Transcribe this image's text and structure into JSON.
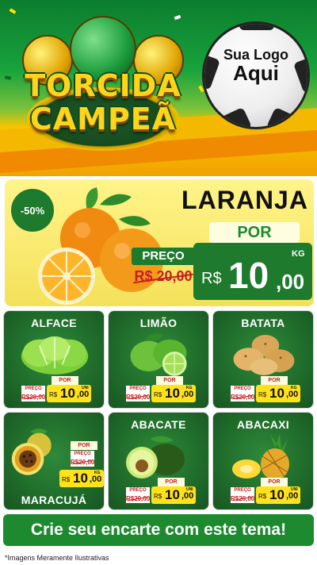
{
  "header": {
    "title_line1": "TORCIDA",
    "title_line2": "CAMPEÃ",
    "logo_line1": "Sua Logo",
    "logo_line2": "Aqui"
  },
  "featured": {
    "discount": "-50%",
    "name": "LARANJA",
    "por_label": "POR",
    "preco_label": "PREÇO",
    "old_price": "R$ 20,00",
    "currency": "R$",
    "price_int": "10",
    "price_dec": ",00",
    "unit": "KG"
  },
  "products": [
    {
      "name": "ALFACE",
      "por": "POR",
      "preco_label": "PREÇO",
      "old_price": "R$20,00",
      "currency": "R$",
      "price_int": "10",
      "price_dec": ",00",
      "unit": "UNI"
    },
    {
      "name": "LIMÃO",
      "por": "POR",
      "preco_label": "PREÇO",
      "old_price": "R$20,00",
      "currency": "R$",
      "price_int": "10",
      "price_dec": ",00",
      "unit": "KG"
    },
    {
      "name": "BATATA",
      "por": "POR",
      "preco_label": "PREÇO",
      "old_price": "R$20,00",
      "currency": "R$",
      "price_int": "10",
      "price_dec": ",00",
      "unit": "KG"
    },
    {
      "name": "MARACUJÁ",
      "por": "POR",
      "preco_label": "PREÇO",
      "old_price": "R$20,00",
      "currency": "R$",
      "price_int": "10",
      "price_dec": ",00",
      "unit": "KG"
    },
    {
      "name": "ABACATE",
      "por": "POR",
      "preco_label": "PREÇO",
      "old_price": "R$20,00",
      "currency": "R$",
      "price_int": "10",
      "price_dec": ",00",
      "unit": "UNI"
    },
    {
      "name": "ABACAXI",
      "por": "POR",
      "preco_label": "PREÇO",
      "old_price": "R$20,00",
      "currency": "R$",
      "price_int": "10",
      "price_dec": ",00",
      "unit": "UNI"
    }
  ],
  "footer": {
    "cta": "Crie seu encarte com este tema!",
    "disclaimer": "*Imagens Meramente Ilustrativas"
  },
  "colors": {
    "brand_green": "#1e7a2c",
    "brand_yellow": "#ffe21a",
    "price_red": "#c81e1e"
  }
}
